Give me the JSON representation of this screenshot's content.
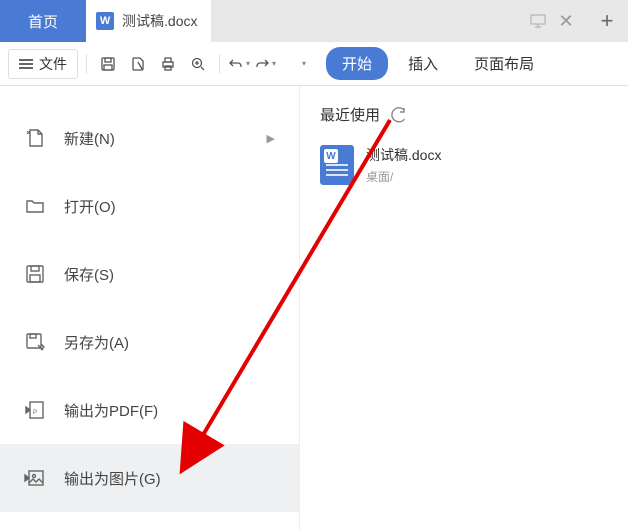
{
  "tabs": {
    "home": "首页",
    "doc": "测试稿.docx"
  },
  "toolbar": {
    "file": "文件",
    "ribbon": {
      "start": "开始",
      "insert": "插入",
      "layout": "页面布局"
    }
  },
  "menu": {
    "new": "新建(N)",
    "open": "打开(O)",
    "save": "保存(S)",
    "saveas": "另存为(A)",
    "pdf": "输出为PDF(F)",
    "img": "输出为图片(G)"
  },
  "recent": {
    "header": "最近使用",
    "items": [
      {
        "name": "测试稿.docx",
        "path": "桌面/"
      }
    ]
  }
}
